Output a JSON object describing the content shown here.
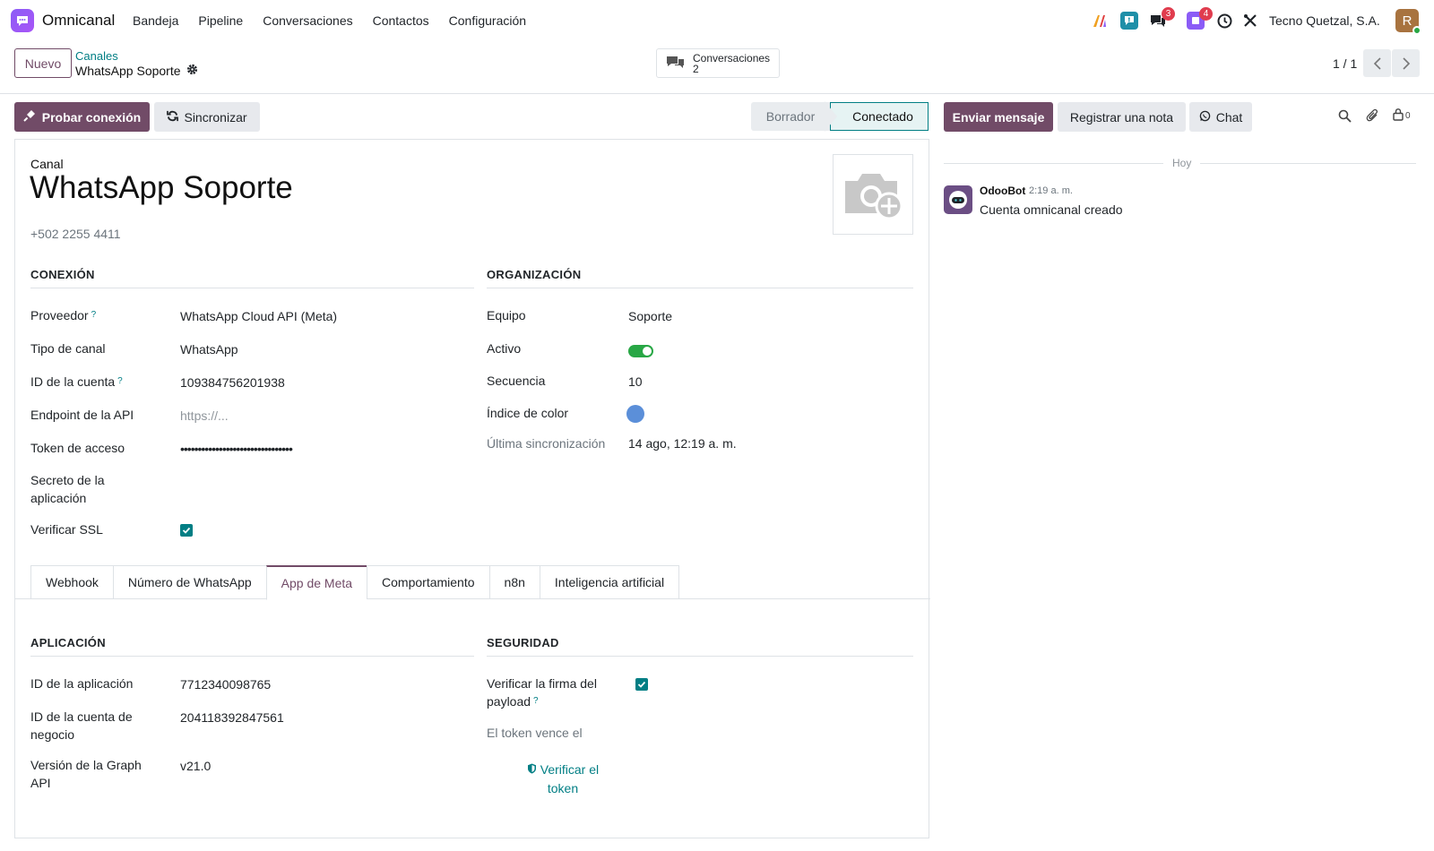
{
  "app": {
    "name": "Omnicanal"
  },
  "menu": [
    "Bandeja",
    "Pipeline",
    "Conversaciones",
    "Contactos",
    "Configuración"
  ],
  "systray": {
    "discuss_badge": "3",
    "activity_badge": "4",
    "company": "Tecno Quetzal, S.A.",
    "avatar_letter": "R"
  },
  "control": {
    "new_label": "Nuevo",
    "breadcrumb_parent": "Canales",
    "breadcrumb_current": "WhatsApp Soporte",
    "smart_label": "Conversaciones",
    "smart_count": "2",
    "pager": "1 / 1"
  },
  "statusbar": {
    "test_label": "Probar conexión",
    "sync_label": "Sincronizar",
    "stages": [
      "Borrador",
      "Conectado"
    ],
    "active_stage": "Conectado"
  },
  "record": {
    "label": "Canal",
    "name": "WhatsApp Soporte",
    "phone": "+502 2255 4411"
  },
  "connection": {
    "title": "CONEXIÓN",
    "fields": [
      {
        "label": "Proveedor",
        "value": "WhatsApp Cloud API (Meta)"
      },
      {
        "label": "Tipo de canal",
        "value": "WhatsApp"
      },
      {
        "label": "ID de la cuenta",
        "value": "109384756201938"
      },
      {
        "label": "Endpoint de la API",
        "placeholder": "https://..."
      },
      {
        "label": "Token de acceso",
        "value": "••••••••••••••••••••••••••••••••"
      },
      {
        "label": "Secreto de la aplicación",
        "value": ""
      },
      {
        "label": "Verificar SSL",
        "checked": true
      }
    ]
  },
  "organization": {
    "title": "ORGANIZACIÓN",
    "fields": [
      {
        "label": "Equipo",
        "value": "Soporte"
      },
      {
        "label": "Activo",
        "on": true
      },
      {
        "label": "Secuencia",
        "value": "10"
      },
      {
        "label": "Índice de color",
        "color": "#5b8fd9"
      },
      {
        "label": "Última sincronización",
        "value": "14 ago, 12:19 a. m."
      }
    ]
  },
  "tabs": [
    "Webhook",
    "Número de WhatsApp",
    "App de Meta",
    "Comportamiento",
    "n8n",
    "Inteligencia artificial"
  ],
  "active_tab": "App de Meta",
  "application": {
    "title": "APLICACIÓN",
    "fields": [
      {
        "label": "ID de la aplicación",
        "value": "7712340098765"
      },
      {
        "label": "ID de la cuenta de negocio",
        "value": "204118392847561"
      },
      {
        "label": "Versión de la Graph API",
        "value": "v21.0"
      }
    ]
  },
  "security": {
    "title": "SEGURIDAD",
    "verify_label": "Verificar la firma del payload",
    "verify_checked": true,
    "expiry_label": "El token vence el",
    "verify_token_label": "Verificar el token"
  },
  "chatter": {
    "send_label": "Enviar mensaje",
    "note_label": "Registrar una nota",
    "chat_label": "Chat",
    "followers_count": "0",
    "day": "Hoy",
    "messages": [
      {
        "author": "OdooBot",
        "date": "2:19 a. m.",
        "body": "Cuenta omnicanal creado"
      }
    ]
  },
  "colors": {
    "primary": "#714b67",
    "accent": "#017e84",
    "success": "#28a745",
    "badge": "#e03c4e"
  }
}
